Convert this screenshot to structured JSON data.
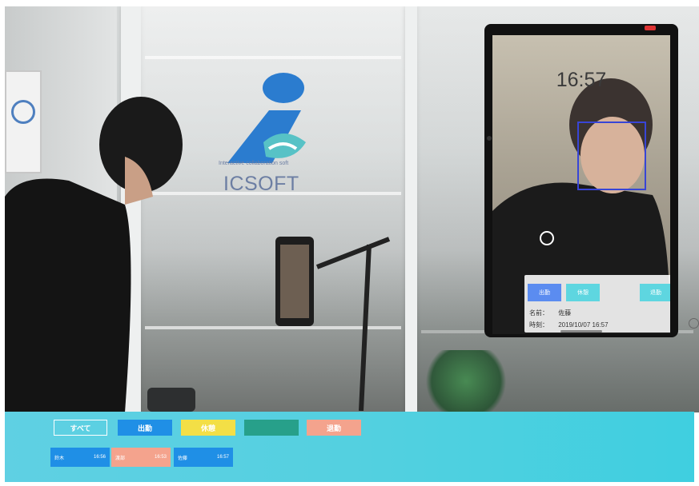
{
  "logo": {
    "name": "ICSOFT",
    "tagline": "Interactive collaboration soft"
  },
  "ipad": {
    "clock": "16:57",
    "buttons": {
      "clock_in": "出勤",
      "break": "休憩",
      "clock_out": "退勤"
    },
    "name_label": "名前：",
    "name_value": "佐藤",
    "time_label": "時刻：",
    "time_value": "2019/10/07 16:57"
  },
  "filters": {
    "all": "すべて",
    "clock_in": "出勤",
    "break": "休憩",
    "empty": "",
    "clock_out": "退勤"
  },
  "records": [
    {
      "name": "鈴木",
      "time": "16:56",
      "color": "#1f8fe6"
    },
    {
      "name": "渡部",
      "time": "16:53",
      "color": "#f4a38d"
    },
    {
      "name": "佐藤",
      "time": "16:57",
      "color": "#1f8fe6"
    }
  ],
  "colors": {
    "clock_in": "#1f8fe6",
    "break": "#f3df46",
    "empty": "#27a08a",
    "clock_out": "#f4a38d",
    "panel_clock_in": "#5b8cf0",
    "panel_teal": "#5ed6e0",
    "bar": "#54d0e0"
  }
}
